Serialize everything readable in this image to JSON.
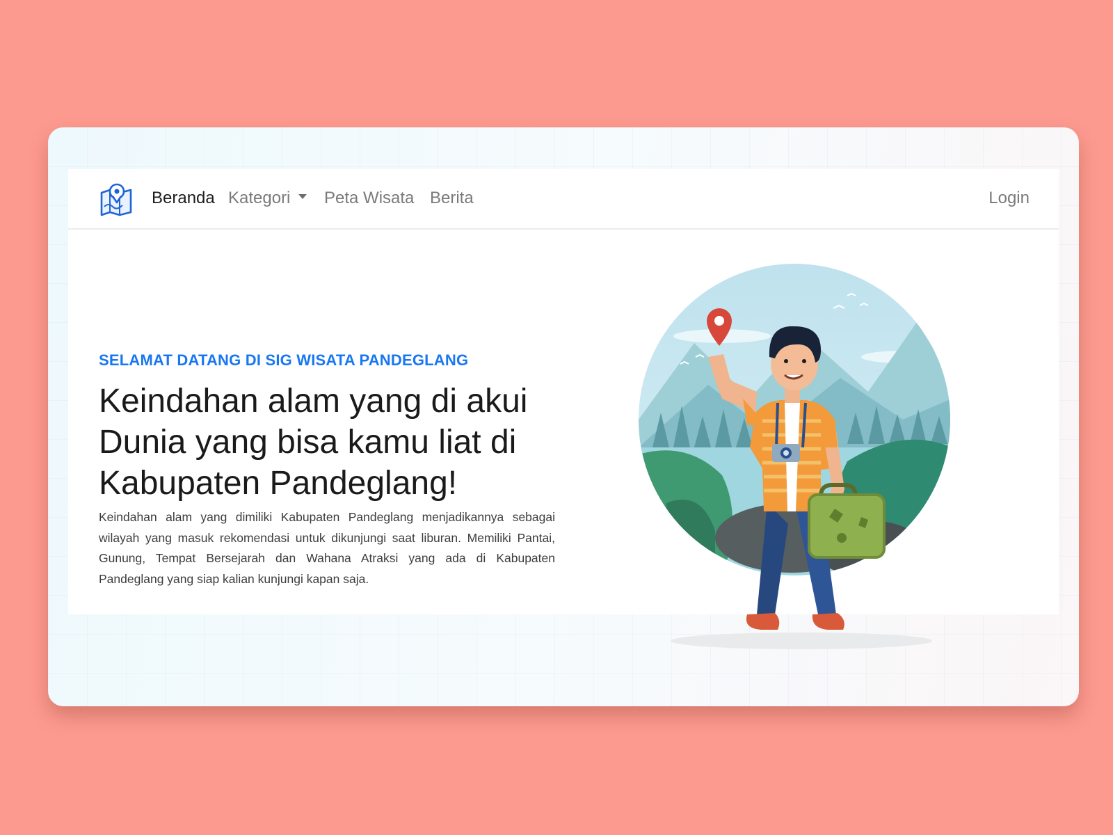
{
  "nav": {
    "logo_icon": "map-pin-logo-icon",
    "items": [
      {
        "label": "Beranda",
        "active": true
      },
      {
        "label": "Kategori",
        "dropdown": true
      },
      {
        "label": "Peta Wisata"
      },
      {
        "label": "Berita"
      }
    ],
    "login_label": "Login"
  },
  "hero": {
    "eyebrow": "SELAMAT DATANG DI SIG WISATA PANDEGLANG",
    "headline_lines": [
      "Keindahan alam yang di akui",
      "Dunia yang bisa kamu liat di",
      "Kabupaten Pandeglang!"
    ],
    "description": "Keindahan alam yang dimiliki Kabupaten Pandeglang menjadikannya sebagai wilayah yang masuk rekomendasi untuk dikunjungi saat liburan. Memiliki Pantai, Gunung, Tempat Bersejarah dan Wahana Atraksi yang ada di Kabupaten Pandeglang yang siap kalian kunjungi kapan saja.",
    "illustration": "traveler-with-map-pin-illustration"
  },
  "colors": {
    "page_bg": "#fd9a8f",
    "accent": "#1877f2",
    "heading": "#1a1a1a",
    "nav_text": "#7a7a7a"
  }
}
